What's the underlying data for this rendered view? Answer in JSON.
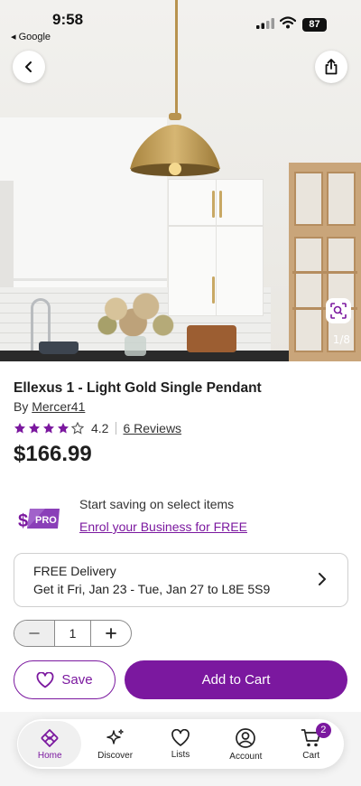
{
  "status_bar": {
    "time": "9:58",
    "back_app": "◂ Google",
    "battery": "87"
  },
  "hero": {
    "image_counter": "1/8"
  },
  "product": {
    "title": "Ellexus 1 - Light Gold Single Pendant",
    "by_prefix": "By ",
    "brand": "Mercer41",
    "rating_value": "4.2",
    "stars_filled": 4,
    "reviews_label": "6 Reviews",
    "price": "$166.99"
  },
  "pro_promo": {
    "badge_label": "PRO",
    "text": "Start saving on select items",
    "link": "Enrol your Business for FREE"
  },
  "delivery": {
    "line1": "FREE Delivery",
    "line2": "Get it Fri, Jan 23 - Tue, Jan 27 to L8E 5S9"
  },
  "quantity": {
    "value": "1"
  },
  "actions": {
    "save_label": "Save",
    "add_to_cart_label": "Add to Cart"
  },
  "nav": {
    "items": [
      {
        "label": "Home",
        "icon": "home-icon",
        "active": true
      },
      {
        "label": "Discover",
        "icon": "sparkle-icon",
        "active": false
      },
      {
        "label": "Lists",
        "icon": "heart-icon",
        "active": false
      },
      {
        "label": "Account",
        "icon": "account-icon",
        "active": false
      },
      {
        "label": "Cart",
        "icon": "cart-icon",
        "active": false
      }
    ],
    "cart_count": "2"
  },
  "colors": {
    "brand": "#7b189f"
  }
}
